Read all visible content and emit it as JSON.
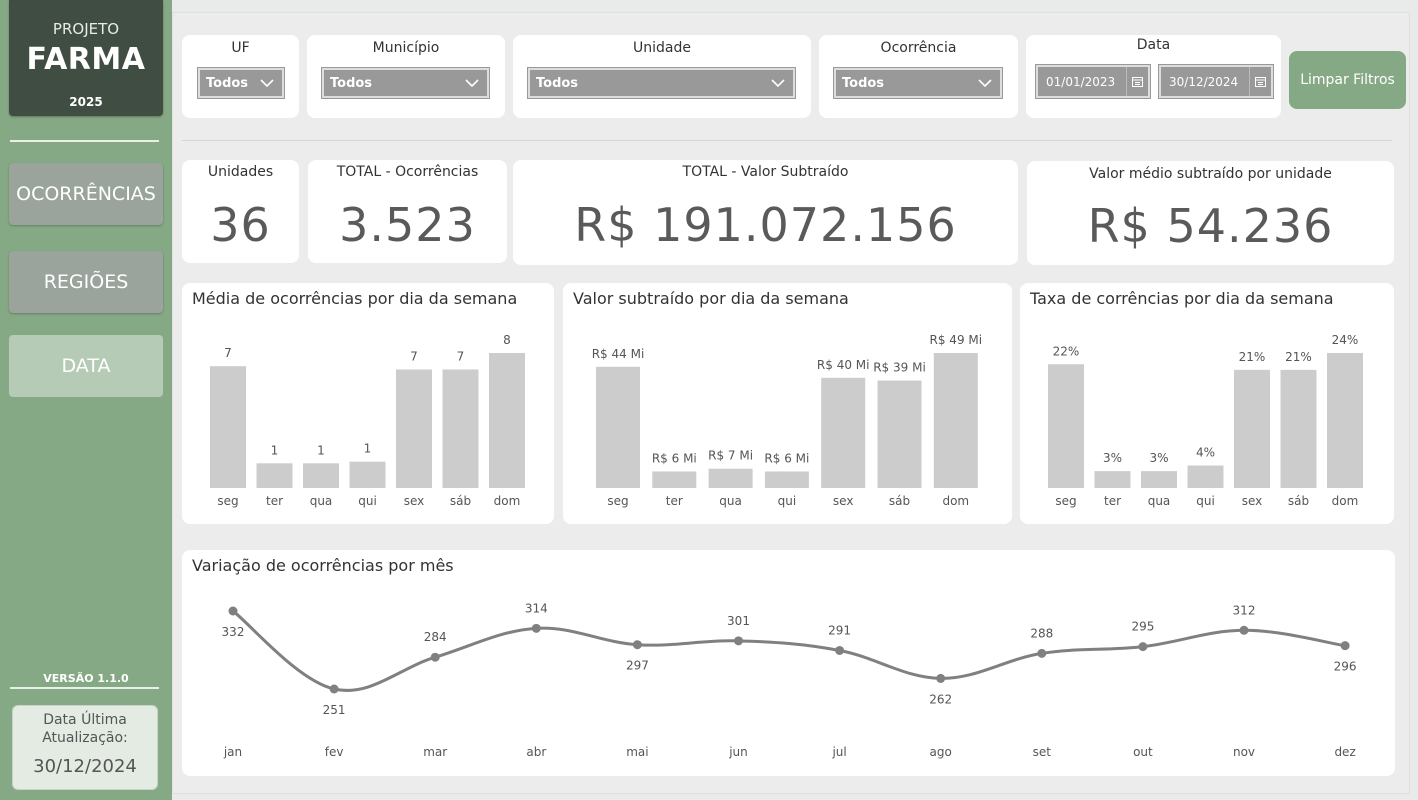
{
  "sidebar": {
    "brand_pre": "PROJETO",
    "brand_main": "FARMA",
    "brand_year": "2025",
    "nav": [
      {
        "label": "OCORRÊNCIAS"
      },
      {
        "label": "REGIÕES"
      },
      {
        "label": "DATA"
      }
    ],
    "version": "VERSÃO 1.1.0",
    "last_update_label": "Data Última Atualização:",
    "last_update_date": "30/12/2024"
  },
  "filters": {
    "uf": {
      "title": "UF",
      "value": "Todos"
    },
    "municipio": {
      "title": "Município",
      "value": "Todos"
    },
    "unidade": {
      "title": "Unidade",
      "value": "Todos"
    },
    "ocorrencia": {
      "title": "Ocorrência",
      "value": "Todos"
    },
    "data": {
      "title": "Data",
      "start": "01/01/2023",
      "end": "30/12/2024"
    },
    "clear_label": "Limpar Filtros"
  },
  "kpis": {
    "unidades": {
      "title": "Unidades",
      "value": "36"
    },
    "ocorrencias": {
      "title": "TOTAL - Ocorrências",
      "value": "3.523"
    },
    "valor": {
      "title": "TOTAL - Valor Subtraído",
      "value": "R$ 191.072.156"
    },
    "media": {
      "title": "Valor médio subtraído por unidade",
      "value": "R$ 54.236"
    }
  },
  "colors": {
    "sidebar": "#86a985",
    "brand": "#3f4d43",
    "bar": "#cccccc",
    "line": "#808080"
  },
  "chart_data": [
    {
      "type": "bar",
      "title": "Média de ocorrências por dia da semana",
      "categories": [
        "seg",
        "ter",
        "qua",
        "qui",
        "sex",
        "sáb",
        "dom"
      ],
      "values": [
        7.4,
        1.5,
        1.5,
        1.6,
        7.2,
        7.2,
        8.2
      ],
      "data_labels": [
        "7",
        "1",
        "1",
        "1",
        "7",
        "7",
        "8"
      ]
    },
    {
      "type": "bar",
      "title": "Valor subtraído por dia da semana",
      "categories": [
        "seg",
        "ter",
        "qua",
        "qui",
        "sex",
        "sáb",
        "dom"
      ],
      "values": [
        44,
        6,
        7,
        6,
        40,
        39,
        49
      ],
      "data_labels": [
        "R$ 44 Mi",
        "R$ 6 Mi",
        "R$ 7 Mi",
        "R$ 6 Mi",
        "R$ 40 Mi",
        "R$ 39 Mi",
        "R$ 49 Mi"
      ]
    },
    {
      "type": "bar",
      "title": "Taxa de corrências por dia da semana",
      "categories": [
        "seg",
        "ter",
        "qua",
        "qui",
        "sex",
        "sáb",
        "dom"
      ],
      "values": [
        22,
        3,
        3,
        4,
        21,
        21,
        24
      ],
      "data_labels": [
        "22%",
        "3%",
        "3%",
        "4%",
        "21%",
        "21%",
        "24%"
      ]
    },
    {
      "type": "line",
      "title": "Variação de ocorrências por mês",
      "categories": [
        "jan",
        "fev",
        "mar",
        "abr",
        "mai",
        "jun",
        "jul",
        "ago",
        "set",
        "out",
        "nov",
        "dez"
      ],
      "values": [
        332,
        251,
        284,
        314,
        297,
        301,
        291,
        262,
        288,
        295,
        312,
        296
      ],
      "label_position": [
        "below",
        "below",
        "above",
        "above",
        "below",
        "above",
        "above",
        "below",
        "above",
        "above",
        "above",
        "below"
      ]
    }
  ]
}
